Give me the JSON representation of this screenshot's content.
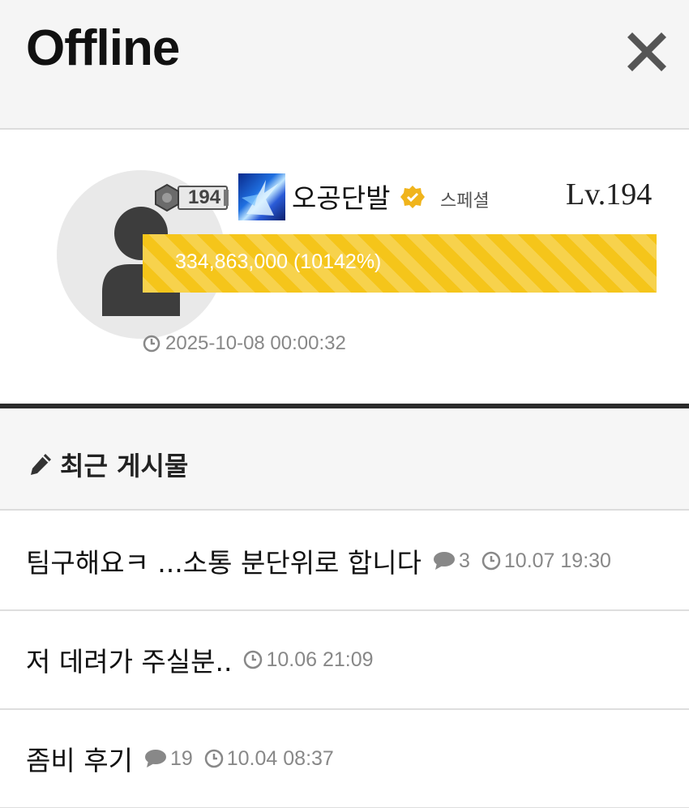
{
  "header": {
    "title": "Offline"
  },
  "profile": {
    "rank": "194",
    "nickname": "오공단발",
    "tier": "스페셜",
    "level": "Lv.194",
    "xp_text": "334,863,000 (10142%)",
    "xp_progress": 1.0,
    "last_seen": "2025-10-08 00:00:32",
    "accent_color": "#f5c51a"
  },
  "recent": {
    "heading": "최근 게시물",
    "posts": [
      {
        "title": "팀구해요ㅋ ...소통 분단위로 합니다",
        "comments": "3",
        "time": "10.07 19:30"
      },
      {
        "title": "저 데려가 주실분..",
        "comments": "",
        "time": "10.06 21:09"
      },
      {
        "title": "좀비 후기",
        "comments": "19",
        "time": "10.04 08:37"
      }
    ]
  }
}
